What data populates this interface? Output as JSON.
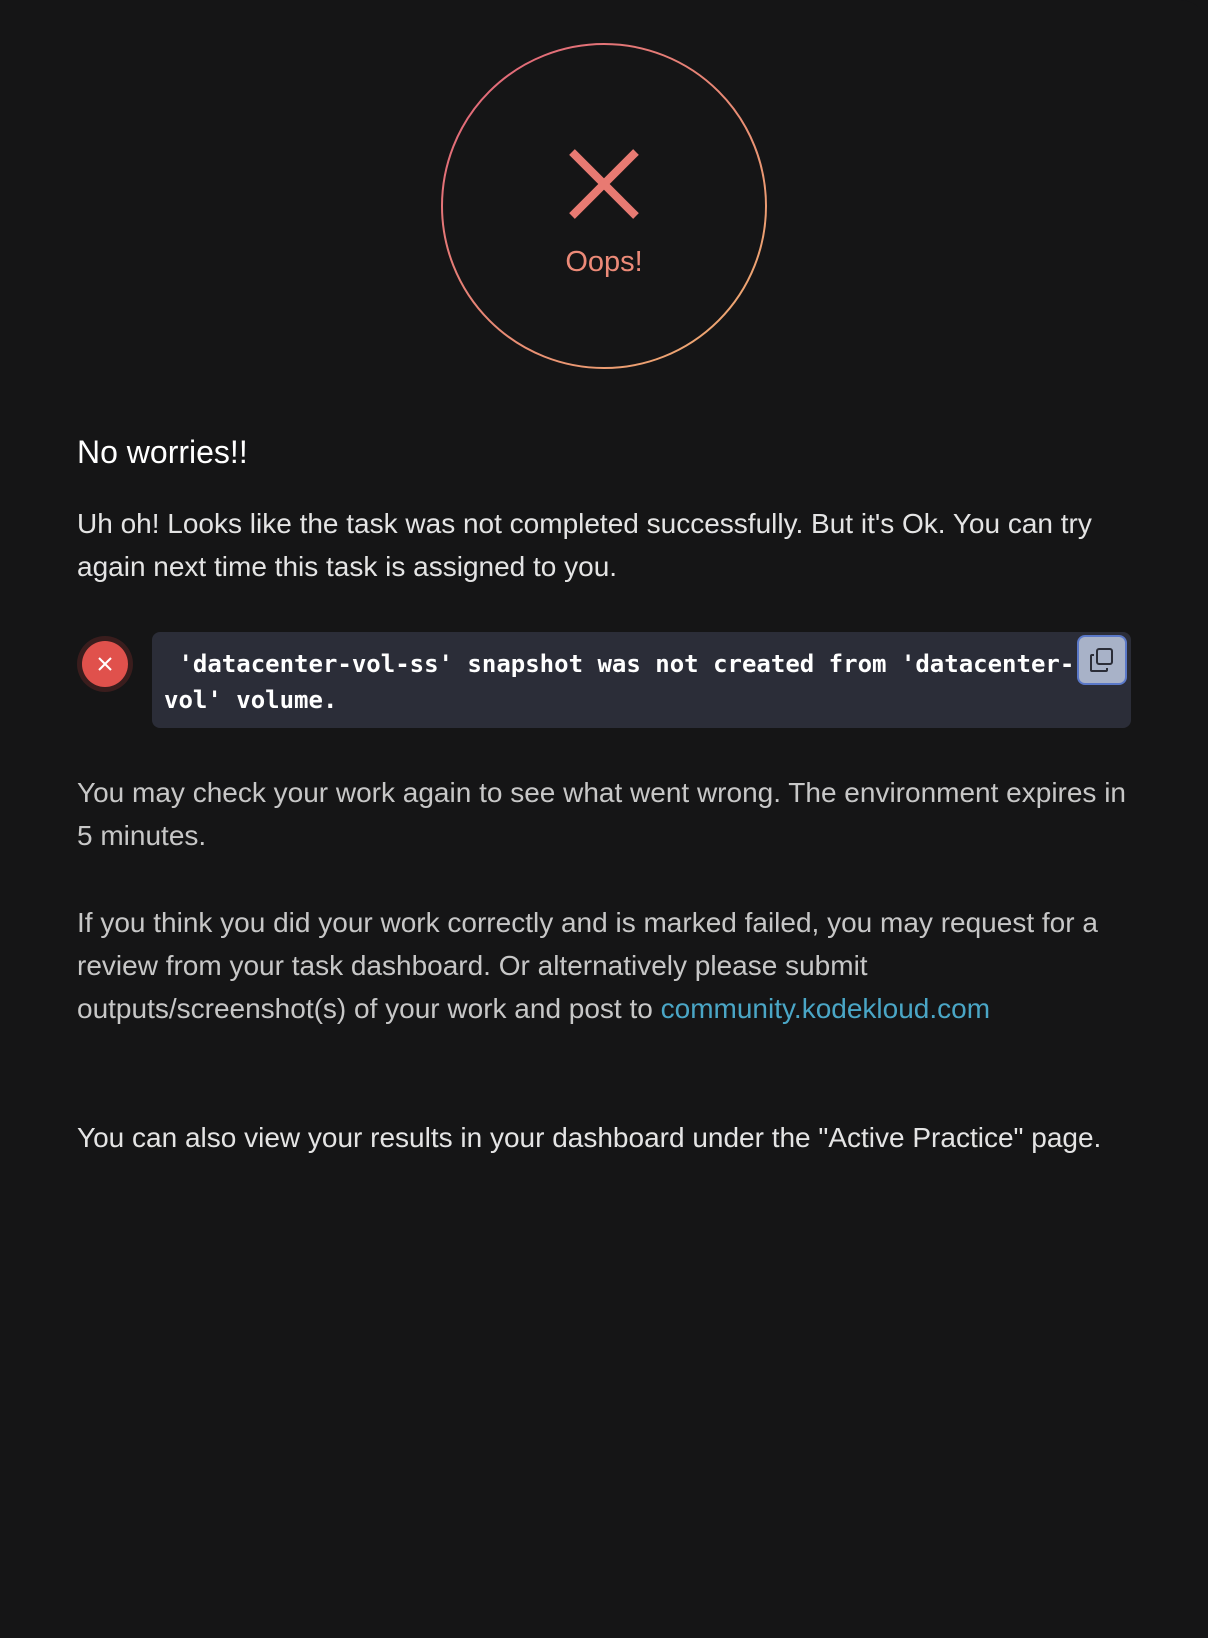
{
  "badge": {
    "label": "Oops!",
    "ring_gradient": [
      "#e0607a",
      "#f0b070"
    ],
    "x_color": "#e87a72",
    "icon": "close-icon"
  },
  "heading": "No worries!!",
  "intro": "Uh oh! Looks like the task was not completed successfully. But it's Ok. You can try again next time this task is assigned to you.",
  "result": {
    "status_icon": "error-x-icon",
    "status_color": "#e0514c",
    "message": " 'datacenter-vol-ss' snapshot was not created from 'datacenter-\nvol' volume.",
    "copy_icon": "copy-icon"
  },
  "check_again": "You may check your work again to see what went wrong. The environment expires in 5 minutes.",
  "review": {
    "text": "If you think you did your work correctly and is marked failed, you may request for a review from your task dashboard. Or alternatively please submit outputs/screenshot(s) of your work and post to ",
    "link_text": "community.kodekloud.com",
    "link_color": "#4aa6c6"
  },
  "footer": "You can also view your results in your dashboard under the \"Active Practice\" page."
}
